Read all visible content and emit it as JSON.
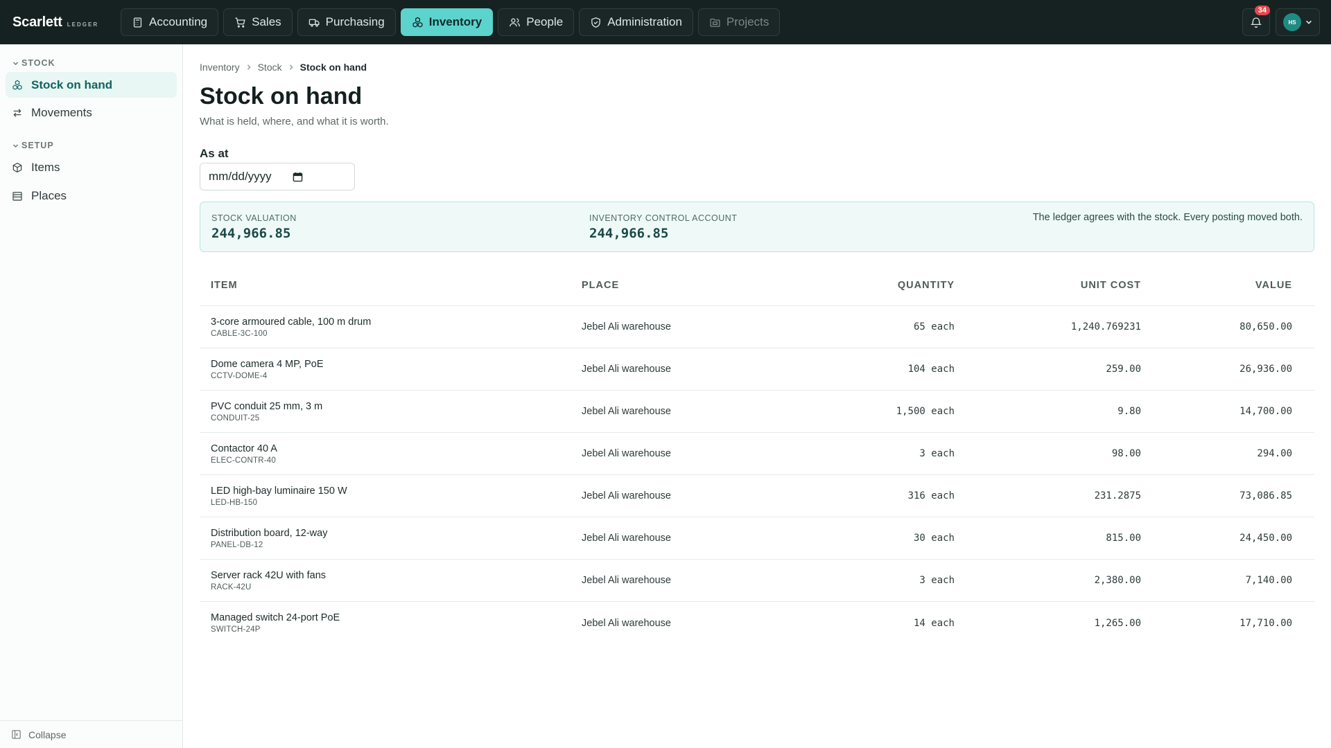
{
  "app": {
    "brand": "Scarlett",
    "brand_sub": "LEDGER"
  },
  "nav": [
    {
      "label": "Accounting",
      "icon": "calculator-icon",
      "state": "normal"
    },
    {
      "label": "Sales",
      "icon": "cart-icon",
      "state": "normal"
    },
    {
      "label": "Purchasing",
      "icon": "truck-icon",
      "state": "normal"
    },
    {
      "label": "Inventory",
      "icon": "boxes-icon",
      "state": "active"
    },
    {
      "label": "People",
      "icon": "users-icon",
      "state": "normal"
    },
    {
      "label": "Administration",
      "icon": "shield-icon",
      "state": "normal"
    },
    {
      "label": "Projects",
      "icon": "folder-icon",
      "state": "disabled"
    }
  ],
  "notifications": {
    "count": "34"
  },
  "user": {
    "initials": "HS"
  },
  "sidebar": {
    "sections": [
      {
        "title": "STOCK",
        "items": [
          {
            "label": "Stock on hand",
            "icon": "boxes-icon",
            "active": true
          },
          {
            "label": "Movements",
            "icon": "arrows-icon",
            "active": false
          }
        ]
      },
      {
        "title": "SETUP",
        "items": [
          {
            "label": "Items",
            "icon": "package-icon",
            "active": false
          },
          {
            "label": "Places",
            "icon": "building-icon",
            "active": false
          }
        ]
      }
    ],
    "collapse_label": "Collapse"
  },
  "breadcrumb": [
    "Inventory",
    "Stock",
    "Stock on hand"
  ],
  "page": {
    "title": "Stock on hand",
    "subtitle": "What is held, where, and what it is worth.",
    "as_at_label": "As at",
    "as_at_placeholder": "mm/dd/yyyy"
  },
  "summary": {
    "valuation_label": "STOCK VALUATION",
    "valuation_value": "244,966.85",
    "control_label": "INVENTORY CONTROL ACCOUNT",
    "control_value": "244,966.85",
    "note": "The ledger agrees with the stock. Every posting moved both."
  },
  "table": {
    "columns": {
      "item": "ITEM",
      "place": "PLACE",
      "quantity": "QUANTITY",
      "unit_cost": "UNIT COST",
      "value": "VALUE"
    },
    "rows": [
      {
        "name": "3-core armoured cable, 100 m drum",
        "sku": "CABLE-3C-100",
        "place": "Jebel Ali warehouse",
        "qty": "65 each",
        "unit_cost": "1,240.769231",
        "value": "80,650.00"
      },
      {
        "name": "Dome camera 4 MP, PoE",
        "sku": "CCTV-DOME-4",
        "place": "Jebel Ali warehouse",
        "qty": "104 each",
        "unit_cost": "259.00",
        "value": "26,936.00"
      },
      {
        "name": "PVC conduit 25 mm, 3 m",
        "sku": "CONDUIT-25",
        "place": "Jebel Ali warehouse",
        "qty": "1,500 each",
        "unit_cost": "9.80",
        "value": "14,700.00"
      },
      {
        "name": "Contactor 40 A",
        "sku": "ELEC-CONTR-40",
        "place": "Jebel Ali warehouse",
        "qty": "3 each",
        "unit_cost": "98.00",
        "value": "294.00"
      },
      {
        "name": "LED high-bay luminaire 150 W",
        "sku": "LED-HB-150",
        "place": "Jebel Ali warehouse",
        "qty": "316 each",
        "unit_cost": "231.2875",
        "value": "73,086.85"
      },
      {
        "name": "Distribution board, 12-way",
        "sku": "PANEL-DB-12",
        "place": "Jebel Ali warehouse",
        "qty": "30 each",
        "unit_cost": "815.00",
        "value": "24,450.00"
      },
      {
        "name": "Server rack 42U with fans",
        "sku": "RACK-42U",
        "place": "Jebel Ali warehouse",
        "qty": "3 each",
        "unit_cost": "2,380.00",
        "value": "7,140.00"
      },
      {
        "name": "Managed switch 24-port PoE",
        "sku": "SWITCH-24P",
        "place": "Jebel Ali warehouse",
        "qty": "14 each",
        "unit_cost": "1,265.00",
        "value": "17,710.00"
      }
    ]
  }
}
